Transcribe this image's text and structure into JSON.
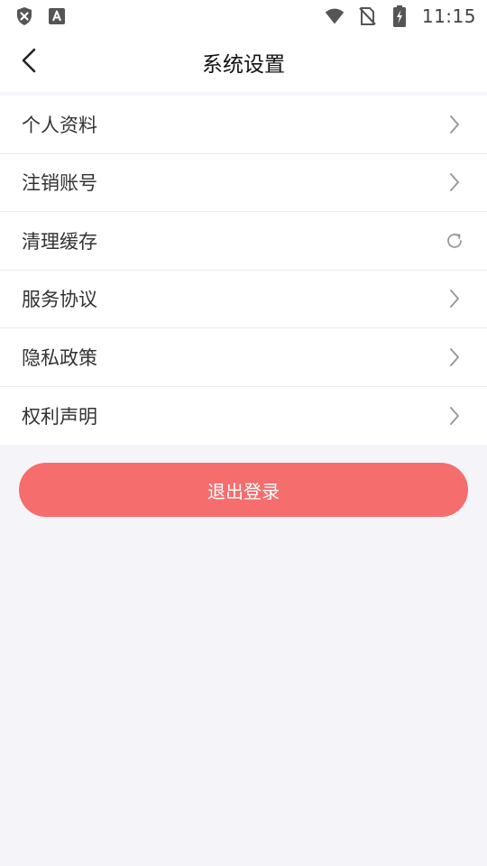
{
  "status_bar": {
    "time": "11:15",
    "left_icons": [
      "shield-x-icon",
      "font-a-icon"
    ],
    "right_icons": [
      "wifi-icon",
      "no-sim-icon",
      "battery-charging-icon"
    ]
  },
  "header": {
    "title": "系统设置",
    "back_icon": "chevron-left-icon"
  },
  "settings": {
    "items": [
      {
        "label": "个人资料",
        "icon": "chevron-right-icon"
      },
      {
        "label": "注销账号",
        "icon": "chevron-right-icon"
      },
      {
        "label": "清理缓存",
        "icon": "refresh-icon"
      },
      {
        "label": "服务协议",
        "icon": "chevron-right-icon"
      },
      {
        "label": "隐私政策",
        "icon": "chevron-right-icon"
      },
      {
        "label": "权利声明",
        "icon": "chevron-right-icon"
      }
    ]
  },
  "logout": {
    "label": "退出登录"
  },
  "colors": {
    "accent": "#f56d6d",
    "background": "#f5f4f9",
    "surface": "#ffffff",
    "divider": "#ececef",
    "chevron": "#9a9a9a"
  }
}
